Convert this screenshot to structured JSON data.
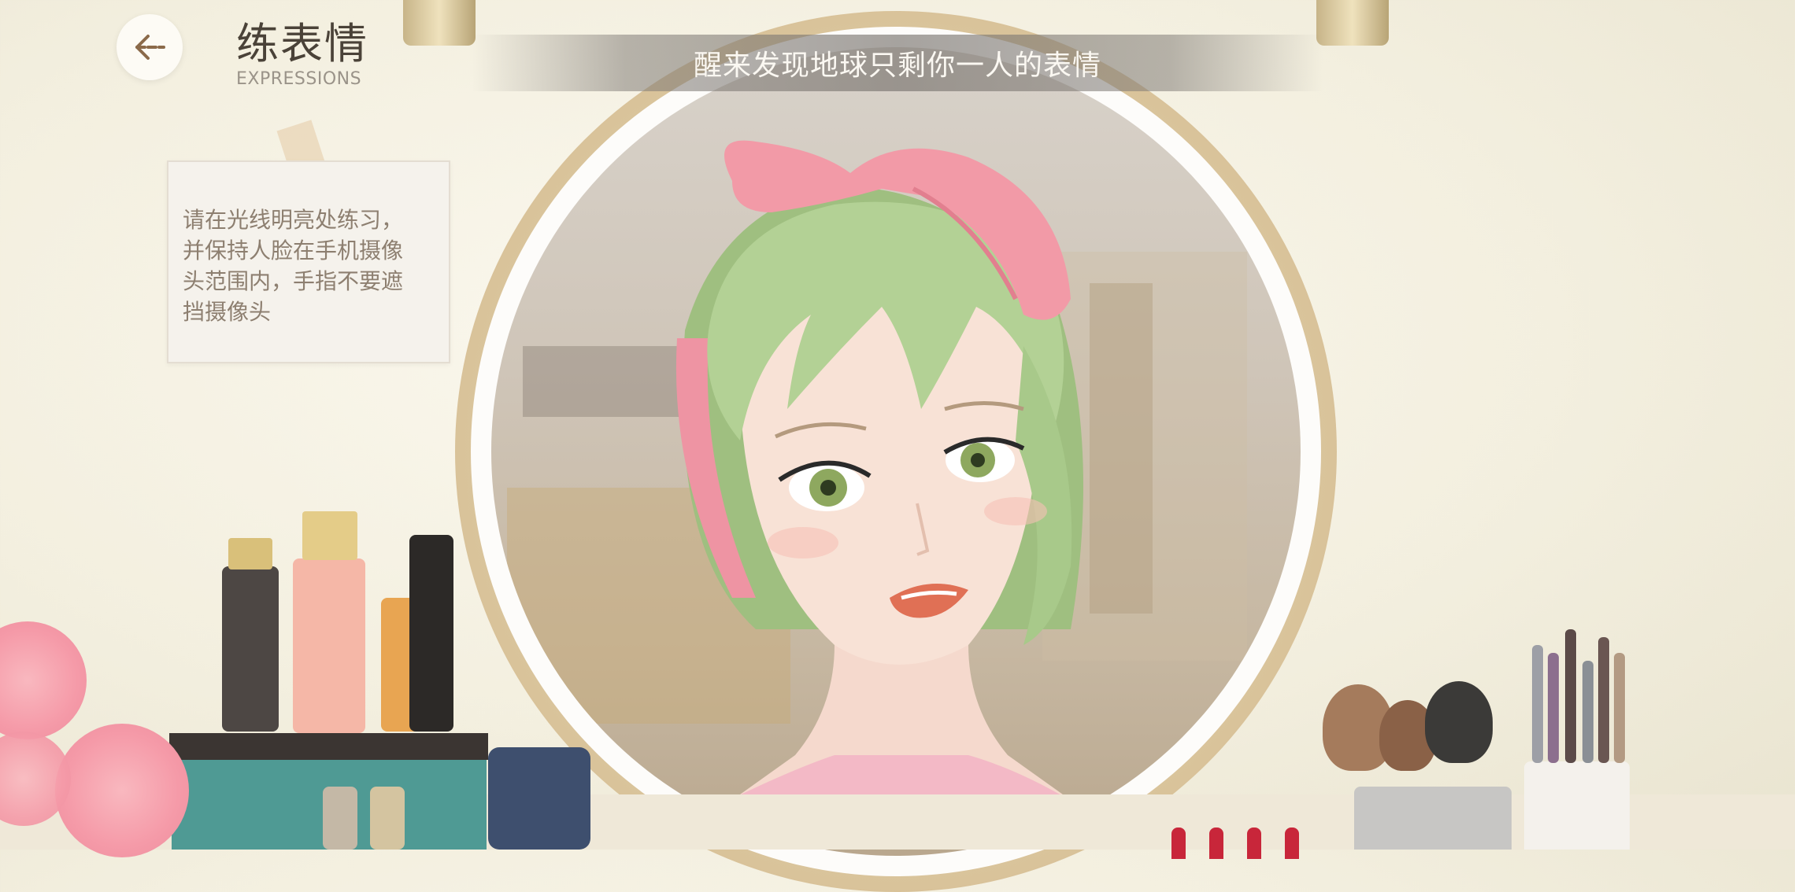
{
  "header": {
    "back_label": "",
    "title": "练表情",
    "subtitle": "EXPRESSIONS"
  },
  "banner": {
    "prompt": "醒来发现地球只剩你一人的表情"
  },
  "tip": {
    "lines": [
      "请在光线明亮处练习，",
      "并保持人脸在手机摄像",
      "头范围内，手指不要遮",
      "挡摄像头"
    ]
  },
  "colors": {
    "hair": "#a8c98a",
    "ribbon": "#f29aa7",
    "mirror_frame": "#d4bc8e",
    "background": "#f3efdf"
  },
  "icons": {
    "back": "arrow-left-icon"
  }
}
